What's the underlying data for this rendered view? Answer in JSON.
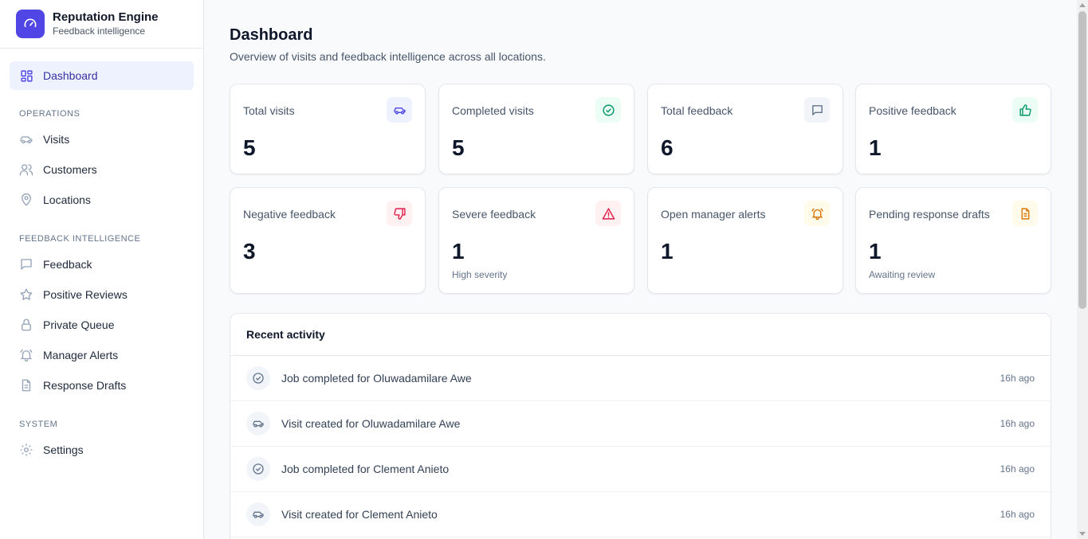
{
  "brand": {
    "title": "Reputation Engine",
    "subtitle": "Feedback intelligence"
  },
  "sidebar": {
    "dashboard": "Dashboard",
    "sections": {
      "operations": "OPERATIONS",
      "feedback_intelligence": "FEEDBACK INTELLIGENCE",
      "system": "SYSTEM"
    },
    "items": {
      "visits": "Visits",
      "customers": "Customers",
      "locations": "Locations",
      "feedback": "Feedback",
      "positive_reviews": "Positive Reviews",
      "private_queue": "Private Queue",
      "manager_alerts": "Manager Alerts",
      "response_drafts": "Response Drafts",
      "settings": "Settings"
    }
  },
  "header": {
    "title": "Dashboard",
    "subtitle": "Overview of visits and feedback intelligence across all locations."
  },
  "stats": [
    {
      "label": "Total visits",
      "value": "5",
      "note": "",
      "icon": "car-icon",
      "color": "#4f46e5",
      "bg": "#eef2ff"
    },
    {
      "label": "Completed visits",
      "value": "5",
      "note": "",
      "icon": "check-circle-icon",
      "color": "#059669",
      "bg": "#ecfdf5"
    },
    {
      "label": "Total feedback",
      "value": "6",
      "note": "",
      "icon": "message-icon",
      "color": "#64748b",
      "bg": "#f1f5f9"
    },
    {
      "label": "Positive feedback",
      "value": "1",
      "note": "",
      "icon": "thumbs-up-icon",
      "color": "#059669",
      "bg": "#ecfdf5"
    },
    {
      "label": "Negative feedback",
      "value": "3",
      "note": "",
      "icon": "thumbs-down-icon",
      "color": "#e11d48",
      "bg": "#fff1f2"
    },
    {
      "label": "Severe feedback",
      "value": "1",
      "note": "High severity",
      "icon": "warning-icon",
      "color": "#e11d48",
      "bg": "#fff1f2"
    },
    {
      "label": "Open manager alerts",
      "value": "1",
      "note": "",
      "icon": "bell-icon",
      "color": "#d97706",
      "bg": "#fffbeb"
    },
    {
      "label": "Pending response drafts",
      "value": "1",
      "note": "Awaiting review",
      "icon": "document-icon",
      "color": "#d97706",
      "bg": "#fffbeb"
    }
  ],
  "activity": {
    "title": "Recent activity",
    "items": [
      {
        "text": "Job completed for Oluwadamilare Awe",
        "time": "16h ago",
        "icon": "check-circle-icon"
      },
      {
        "text": "Visit created for Oluwadamilare Awe",
        "time": "16h ago",
        "icon": "car-icon"
      },
      {
        "text": "Job completed for Clement Anieto",
        "time": "16h ago",
        "icon": "check-circle-icon"
      },
      {
        "text": "Visit created for Clement Anieto",
        "time": "16h ago",
        "icon": "car-icon"
      }
    ]
  },
  "colors": {
    "accent": "#4f46e5",
    "active_bg": "#eef2ff"
  }
}
